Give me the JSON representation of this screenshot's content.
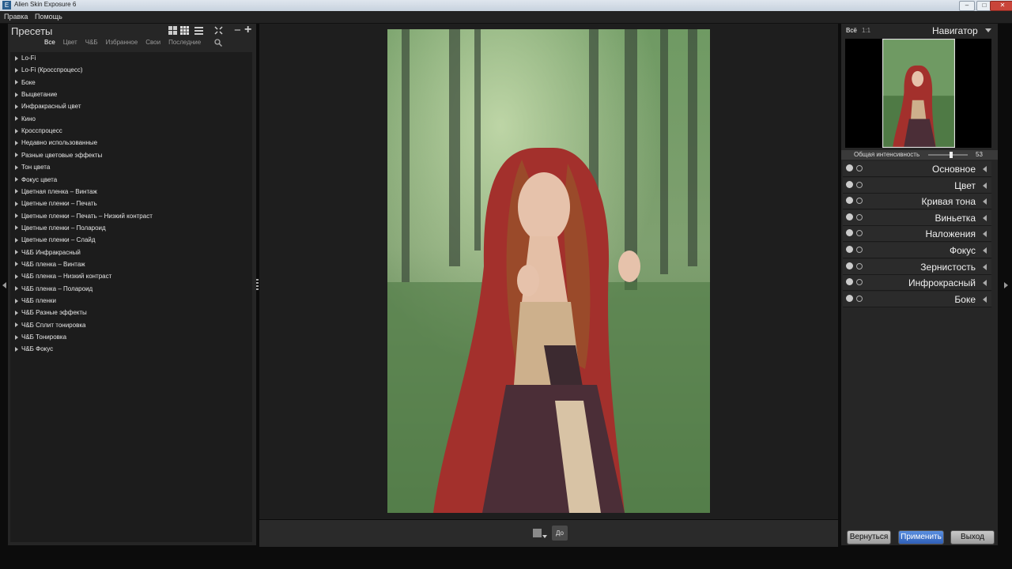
{
  "window": {
    "title": "Alien Skin Exposure 6"
  },
  "menu": [
    "Правка",
    "Помощь"
  ],
  "presets": {
    "title": "Пресеты",
    "tabs": [
      "Все",
      "Цвет",
      "Ч&Б",
      "Избранное",
      "Свои",
      "Последние"
    ],
    "items": [
      "Lo-Fi",
      "Lo-Fi (Кросспроцесс)",
      "Боке",
      "Выцветание",
      "Инфракрасный цвет",
      "Кино",
      "Кросспроцесс",
      "Недавно использованные",
      "Разные цветовые эффекты",
      "Тон цвета",
      "Фокус цвета",
      "Цветная пленка – Винтаж",
      "Цветные пленки – Печать",
      "Цветные пленки – Печать – Низкий контраст",
      "Цветные пленки – Полароид",
      "Цветные пленки – Слайд",
      "Ч&Б Инфракрасный",
      "Ч&Б пленка – Винтаж",
      "Ч&Б пленка – Низкий контраст",
      "Ч&Б пленка – Полароид",
      "Ч&Б пленки",
      "Ч&Б Разные эффекты",
      "Ч&Б Сплит тонировка",
      "Ч&Б Тонировка",
      "Ч&Б Фокус"
    ]
  },
  "bottom": {
    "before_label": "До"
  },
  "navigator": {
    "all_label": "Всё",
    "ratio_label": "1:1",
    "title": "Навигатор",
    "intensity_label": "Общая интенсивность",
    "intensity_value": "53",
    "intensity_level": 0.53
  },
  "panels": [
    "Основное",
    "Цвет",
    "Кривая тона",
    "Виньетка",
    "Наложения",
    "Фокус",
    "Зернистость",
    "Инфрокрасный",
    "Боке"
  ],
  "buttons": {
    "back": "Вернуться",
    "apply": "Применить",
    "exit": "Выход"
  }
}
